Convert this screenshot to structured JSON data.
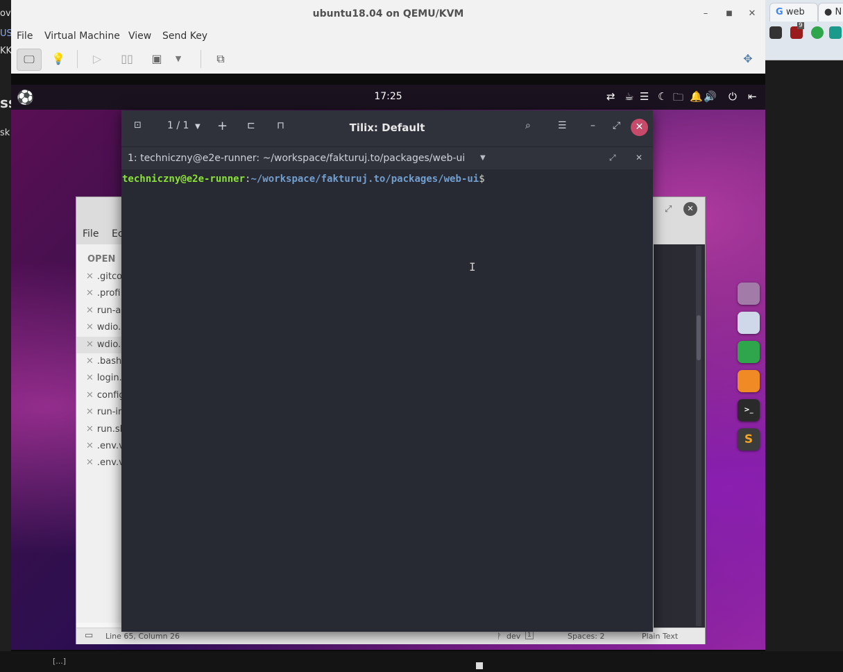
{
  "host": {
    "left_fragments": [
      "ov",
      "US",
      "KK",
      "ss",
      "sk"
    ],
    "browser_tabs": [
      {
        "label": "web"
      },
      {
        "label": "N"
      }
    ],
    "badge_count": "9",
    "bottom_text": "[...]"
  },
  "vm_window": {
    "title": "ubuntu18.04 on QEMU/KVM",
    "menu": [
      "File",
      "Virtual Machine",
      "View",
      "Send Key"
    ]
  },
  "guest": {
    "clock": "17:25",
    "topbar_icons": [
      "ubuntu-logo-icon",
      "network-arrows-icon",
      "coffee-icon",
      "menu-icon",
      "night-light-icon",
      "folder-icon",
      "notification-bell-icon",
      "volume-icon",
      "power-icon",
      "logout-icon"
    ],
    "dock_apps": [
      {
        "name": "files",
        "color": "#a37ba8"
      },
      {
        "name": "web-browser",
        "color": "#cfd8e8"
      },
      {
        "name": "chrome",
        "color": "#2fa64c"
      },
      {
        "name": "firefox",
        "color": "#f08a24"
      },
      {
        "name": "terminal",
        "color": "#2a2a2a"
      },
      {
        "name": "sublime-text",
        "color": "#3c3c3c",
        "glyph": "S"
      }
    ]
  },
  "gedit": {
    "menu": [
      "File",
      "Ec"
    ],
    "sidebar_header": "OPEN",
    "files": [
      ".gitco",
      ".profi",
      "run-a",
      "wdio.",
      "wdio.",
      ".bash",
      "login.",
      "config",
      "run-ir",
      "run.sl",
      ".env.v",
      ".env.v"
    ],
    "selected_index": 4,
    "status": {
      "position": "Line 65, Column 26",
      "branch": "dev",
      "branch_count": "1",
      "spaces": "Spaces: 2",
      "language": "Plain Text"
    }
  },
  "tilix": {
    "title": "Tilix: Default",
    "session_counter": "1 / 1",
    "terminal_title": "1: techniczny@e2e-runner: ~/workspace/fakturuj.to/packages/web-ui",
    "prompt": {
      "user_host": "techniczny@e2e-runner",
      "separator": ":",
      "path": "~/workspace/fakturuj.to/packages/web-ui",
      "symbol": "$"
    }
  }
}
